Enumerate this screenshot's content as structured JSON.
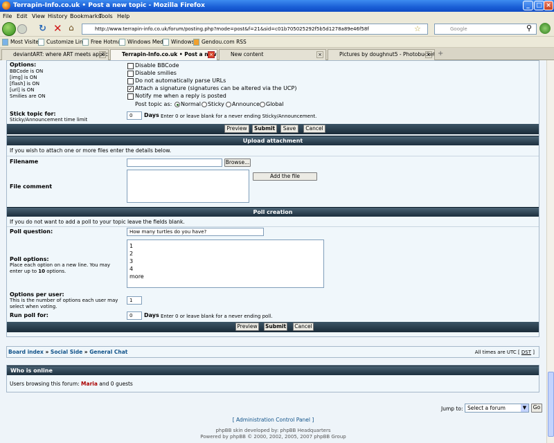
{
  "window": {
    "title": "Terrapin-Info.co.uk • Post a new topic - Mozilla Firefox"
  },
  "menu": [
    "File",
    "Edit",
    "View",
    "History",
    "Bookmarks",
    "Tools",
    "Help"
  ],
  "url": "http://www.terrapin-info.co.uk/forum/posting.php?mode=post&f=21&sid=c01b705025292f5b5d1278a89e46f58f",
  "search_placeholder": "Google",
  "bookmarks": [
    "Most Visited",
    "Customize Links",
    "Free Hotmail",
    "Windows Media",
    "Windows",
    "Gendou.com RSS"
  ],
  "tabs": [
    "deviantART: where ART meets applicat...",
    "Terrapin-Info.co.uk • Post a new ...",
    "New content",
    "Pictures by doughnut5 - Photobucket"
  ],
  "options": {
    "title": "Options:",
    "status": [
      "BBCode is ON",
      "[img] is ON",
      "[flash] is ON",
      "[url] is ON",
      "Smilies are ON"
    ],
    "checkboxes": [
      {
        "label": "Disable BBCode",
        "checked": false
      },
      {
        "label": "Disable smilies",
        "checked": false
      },
      {
        "label": "Do not automatically parse URLs",
        "checked": false
      },
      {
        "label": "Attach a signature (signatures can be altered via the UCP)",
        "checked": true
      },
      {
        "label": "Notify me when a reply is posted",
        "checked": false
      }
    ],
    "post_topic_as": "Post topic as:",
    "radios": [
      "Normal",
      "Sticky",
      "Announce",
      "Global"
    ]
  },
  "sticky": {
    "label": "Stick topic for:",
    "sub": "Sticky/Announcement time limit",
    "value": "0",
    "unit": "Days",
    "hint": "Enter 0 or leave blank for a never ending Sticky/Announcement."
  },
  "buttons1": [
    "Preview",
    "Submit",
    "Save",
    "Cancel"
  ],
  "upload": {
    "header": "Upload attachment",
    "intro": "If you wish to attach one or more files enter the details below.",
    "filename": "Filename",
    "browse": "Browse...",
    "comment": "File comment",
    "add": "Add the file"
  },
  "poll": {
    "header": "Poll creation",
    "intro": "If you do not want to add a poll to your topic leave the fields blank.",
    "question_label": "Poll question:",
    "question_value": "How many turtles do you have?",
    "options_label": "Poll options:",
    "options_hint": "Place each option on a new line. You may enter up to",
    "options_hint_num": "10",
    "options_hint_end": "options.",
    "options_lines": [
      "1",
      "2",
      "3",
      "4",
      "more"
    ],
    "per_user_label": "Options per user:",
    "per_user_hint": "This is the number of options each user may select when voting.",
    "per_user_value": "1",
    "run_label": "Run poll for:",
    "run_value": "0",
    "run_unit": "Days",
    "run_hint": "Enter 0 or leave blank for a never ending poll."
  },
  "buttons2": [
    "Preview",
    "Submit",
    "Cancel"
  ],
  "breadcrumb": {
    "items": [
      "Board index",
      "Social Side",
      "General Chat"
    ],
    "sep": "»",
    "tz_text": "All times are UTC [",
    "dst": "DST",
    "tz_end": "]"
  },
  "online": {
    "header": "Who is online",
    "text": "Users browsing this forum:",
    "user": "Maria",
    "rest": "and 0 guests"
  },
  "jump": {
    "label": "Jump to:",
    "select": "Select a forum",
    "go": "Go"
  },
  "footer": {
    "acp": "[ Administration Control Panel ]",
    "line1": "phpBB skin developed by: phpBB Headquarters",
    "line2": "Powered by phpBB © 2000, 2002, 2005, 2007 phpBB Group"
  }
}
